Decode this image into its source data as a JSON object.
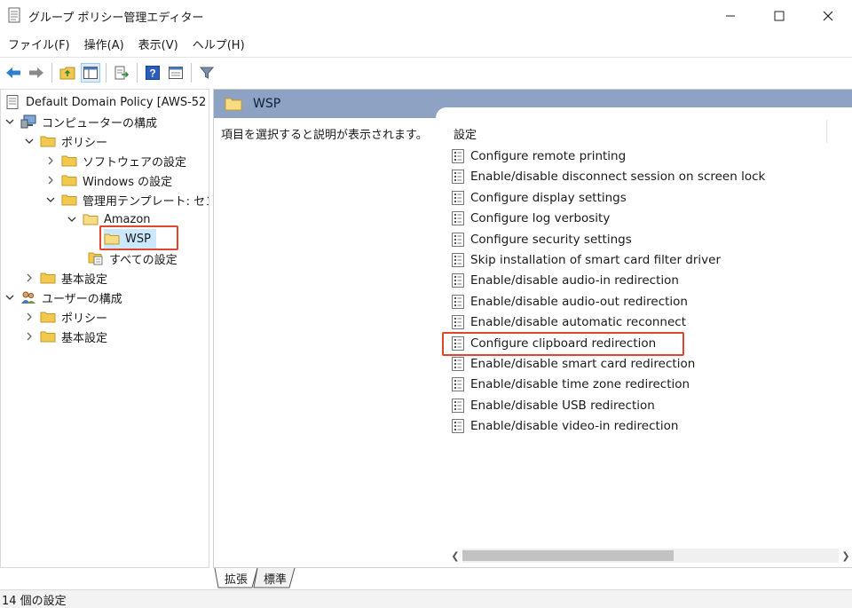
{
  "window": {
    "title": "グループ ポリシー管理エディター",
    "controls": [
      "minimize",
      "maximize",
      "close"
    ]
  },
  "menu": [
    "ファイル(F)",
    "操作(A)",
    "表示(V)",
    "ヘルプ(H)"
  ],
  "toolbar": {
    "buttons": [
      "back-arrow-icon",
      "forward-arrow-icon",
      "up-folder-icon",
      "show-hide-tree-icon",
      "export-list-icon",
      "help-icon",
      "properties-view-icon",
      "filter-icon"
    ]
  },
  "tree": {
    "root": "Default Domain Policy [AWS-52",
    "computer_config": "コンピューターの構成",
    "policy": "ポリシー",
    "software_settings": "ソフトウェアの設定",
    "windows_settings": "Windows の設定",
    "admin_templates": "管理用テンプレート: セン",
    "amazon": "Amazon",
    "wsp": "WSP",
    "all_settings": "すべての設定",
    "basic_settings": "基本設定",
    "user_config": "ユーザーの構成",
    "user_policy": "ポリシー",
    "user_basic_settings": "基本設定"
  },
  "right": {
    "header": "WSP",
    "description": "項目を選択すると説明が表示されます。",
    "column_header": "設定",
    "settings": [
      "Configure remote printing",
      "Enable/disable disconnect session on screen lock",
      "Configure display settings",
      "Configure log verbosity",
      "Configure security settings",
      "Skip installation of smart card filter driver",
      "Enable/disable audio-in redirection",
      "Enable/disable audio-out redirection",
      "Enable/disable automatic reconnect",
      "Configure clipboard redirection",
      "Enable/disable smart card redirection",
      "Enable/disable time zone redirection",
      "Enable/disable USB redirection",
      "Enable/disable video-in redirection"
    ],
    "highlighted_setting": "Configure clipboard redirection"
  },
  "tabs": [
    "拡張",
    "標準"
  ],
  "status": "14 個の設定",
  "colors": {
    "header_band": "#8ea3c4",
    "highlight_border": "#e0452e",
    "selection": "#cce8ff",
    "folder": "#f2c94c"
  }
}
